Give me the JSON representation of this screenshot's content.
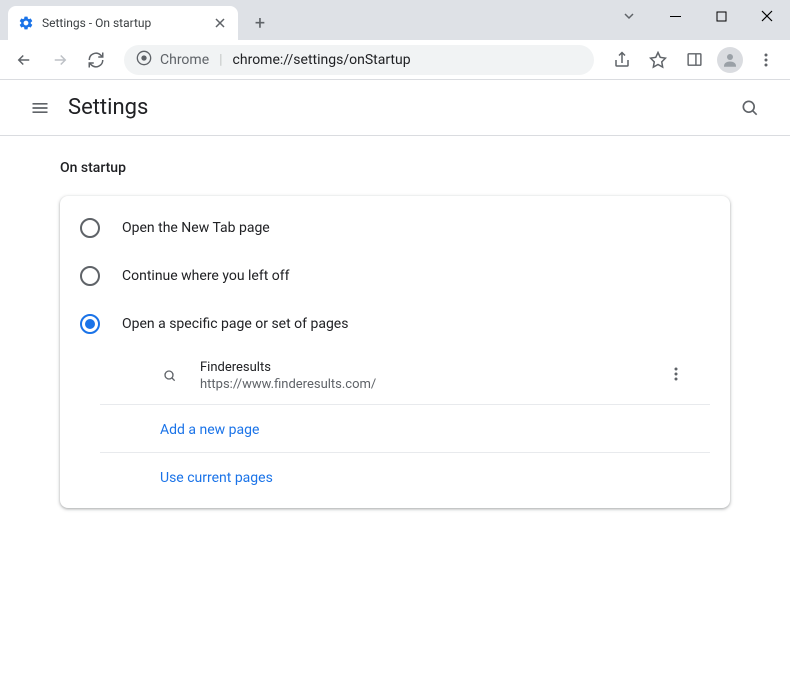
{
  "window": {
    "tab_title": "Settings - On startup"
  },
  "toolbar": {
    "url_scheme": "Chrome",
    "url_path": "chrome://settings/onStartup"
  },
  "header": {
    "title": "Settings"
  },
  "section": {
    "title": "On startup"
  },
  "options": {
    "new_tab": "Open the New Tab page",
    "continue": "Continue where you left off",
    "specific": "Open a specific page or set of pages"
  },
  "startup_page": {
    "name": "Finderesults",
    "url": "https://www.finderesults.com/"
  },
  "actions": {
    "add_page": "Add a new page",
    "use_current": "Use current pages"
  }
}
